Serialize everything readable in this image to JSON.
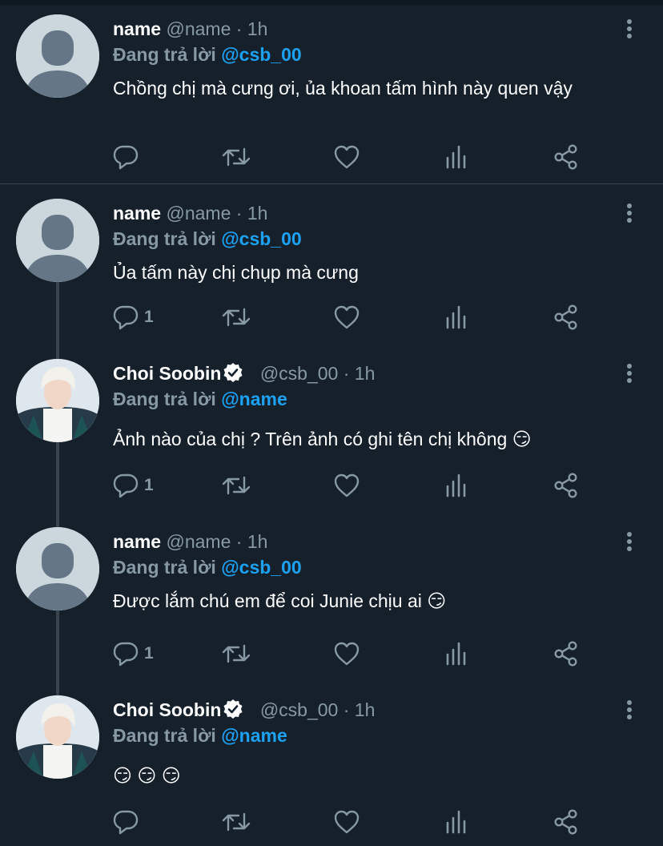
{
  "reply_prefix": "Đang trả lời",
  "tweets": [
    {
      "display_name": "name",
      "handle": "@name",
      "dot": "·",
      "time": "1h",
      "verified": false,
      "avatar": "default-avatar",
      "reply_to": "@csb_00",
      "text": "Chồng chị mà cưng ơi, ủa khoan tấm hình này quen vậy",
      "reply_count": ""
    },
    {
      "display_name": "name",
      "handle": "@name",
      "dot": "·",
      "time": "1h",
      "verified": false,
      "avatar": "default-avatar",
      "reply_to": "@csb_00",
      "text": "Ủa tấm này chị chụp mà cưng",
      "reply_count": "1"
    },
    {
      "display_name": "Choi Soobin",
      "handle": "@csb_00",
      "dot": "·",
      "time": "1h",
      "verified": true,
      "avatar": "photo-avatar",
      "reply_to": "@name",
      "text": "Ảnh nào của chị ? Trên ảnh có ghi tên chị không 😏",
      "reply_count": "1"
    },
    {
      "display_name": "name",
      "handle": "@name",
      "dot": "·",
      "time": "1h",
      "verified": false,
      "avatar": "default-avatar",
      "reply_to": "@csb_00",
      "text": "Được lắm chú em để coi Junie chịu ai 😏",
      "reply_count": "1"
    },
    {
      "display_name": "Choi Soobin",
      "handle": "@csb_00",
      "dot": "·",
      "time": "1h",
      "verified": true,
      "avatar": "photo-avatar",
      "reply_to": "@name",
      "text": "😏 😏 😏",
      "reply_count": ""
    }
  ],
  "icons": {
    "reply": "reply-icon",
    "retweet": "retweet-icon",
    "like": "like-icon",
    "analytics": "analytics-icon",
    "share": "share-icon",
    "more": "more-icon",
    "verified": "verified-badge-icon"
  },
  "colors": {
    "background": "#15202b",
    "secondary_text": "#8899a6",
    "mention": "#1da1f2",
    "divider": "#38444d"
  }
}
